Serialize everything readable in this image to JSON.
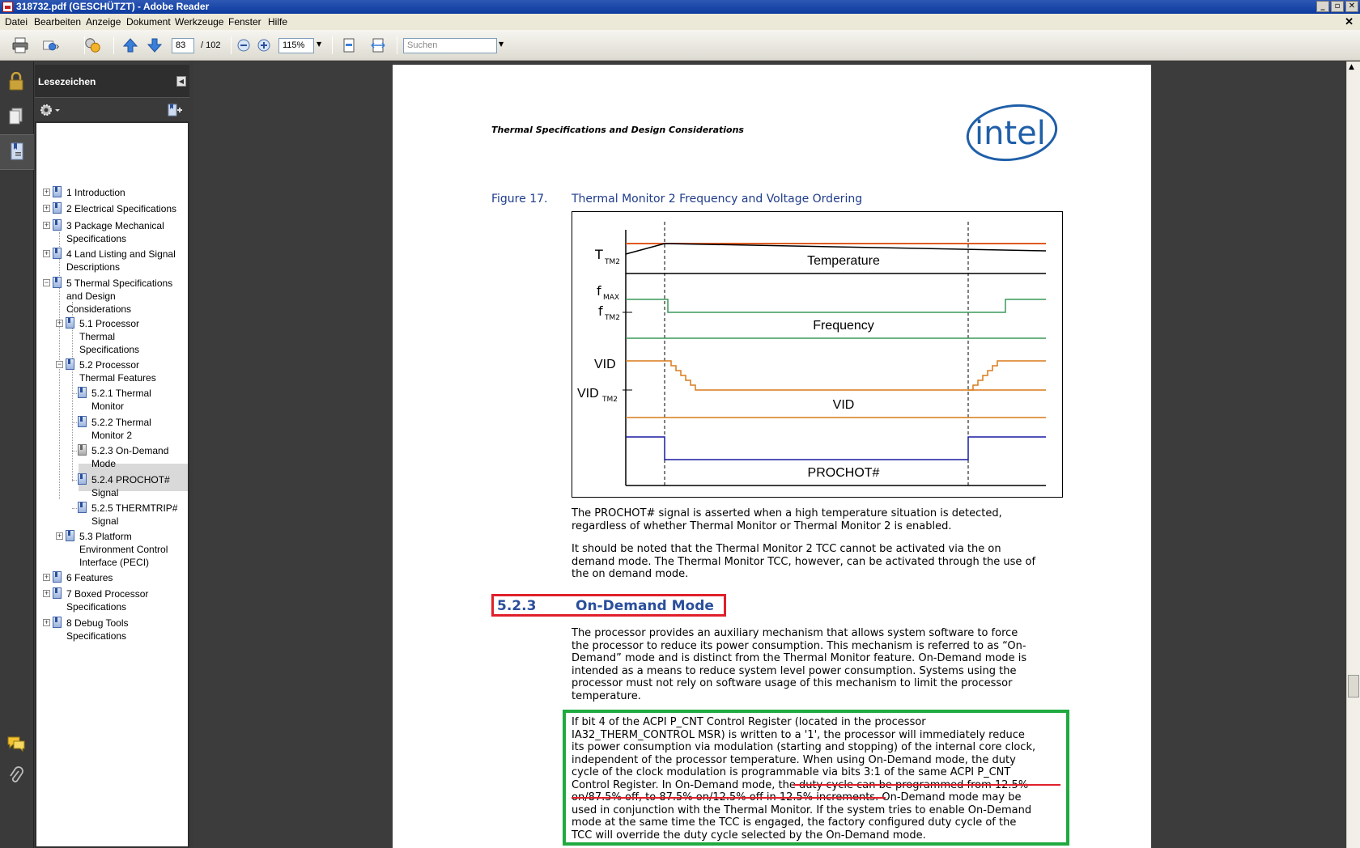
{
  "window": {
    "title": "318732.pdf (GESCHÜTZT) - Adobe Reader"
  },
  "menu": [
    "Datei",
    "Bearbeiten",
    "Anzeige",
    "Dokument",
    "Werkzeuge",
    "Fenster",
    "Hilfe"
  ],
  "toolbar": {
    "page_current": "83",
    "page_total": "/ 102",
    "zoom": "115%",
    "search_placeholder": "Suchen"
  },
  "bookmarks": {
    "title": "Lesezeichen",
    "items": [
      {
        "lines": [
          "1 Introduction"
        ]
      },
      {
        "lines": [
          "2 Electrical Specifications"
        ]
      },
      {
        "lines": [
          "3 Package Mechanical",
          "Specifications"
        ]
      },
      {
        "lines": [
          "4 Land Listing and Signal",
          "Descriptions"
        ]
      },
      {
        "lines": [
          "5 Thermal Specifications",
          "and Design",
          "Considerations"
        ]
      },
      {
        "lines": [
          "5.1 Processor",
          "Thermal",
          "Specifications"
        ]
      },
      {
        "lines": [
          "5.2 Processor",
          "Thermal Features"
        ]
      },
      {
        "lines": [
          "5.2.1 Thermal",
          "Monitor"
        ]
      },
      {
        "lines": [
          "5.2.2 Thermal",
          "Monitor 2"
        ]
      },
      {
        "lines": [
          "5.2.3 On-Demand",
          "Mode"
        ]
      },
      {
        "lines": [
          "5.2.4 PROCHOT#",
          "Signal"
        ]
      },
      {
        "lines": [
          "5.2.5 THERMTRIP#",
          "Signal"
        ]
      },
      {
        "lines": [
          "5.3 Platform",
          "Environment Control",
          "Interface (PECI)"
        ]
      },
      {
        "lines": [
          "6 Features"
        ]
      },
      {
        "lines": [
          "7 Boxed Processor",
          "Specifications"
        ]
      },
      {
        "lines": [
          "8 Debug Tools",
          "Specifications"
        ]
      }
    ]
  },
  "document": {
    "running_header": "Thermal Specifications and Design Considerations",
    "logo_text": "intel",
    "figure": {
      "number": "Figure 17.",
      "title": "Thermal Monitor 2 Frequency and Voltage Ordering",
      "labels": {
        "ttm2_main": "T",
        "ttm2_sub": "TM2",
        "fmax_main": "f",
        "fmax_sub": "MAX",
        "ftm2_main": "f",
        "ftm2_sub": "TM2",
        "vid_left": "VID",
        "vidtm2_main": "VID",
        "vidtm2_sub": "TM2",
        "temperature": "Temperature",
        "frequency": "Frequency",
        "vid_center": "VID",
        "prochot": "PROCHOT#"
      }
    },
    "para1": [
      "The PROCHOT# signal is asserted when a high temperature situation is detected,",
      "regardless of whether Thermal Monitor or Thermal Monitor 2 is enabled."
    ],
    "para2": [
      "It should be noted that the Thermal Monitor 2 TCC cannot be activated via the on",
      "demand mode. The Thermal Monitor TCC, however, can be activated through the use of",
      "the on demand mode."
    ],
    "section": {
      "number": "5.2.3",
      "title": "On-Demand Mode"
    },
    "para3": [
      "The processor provides an auxiliary mechanism that allows system software to force",
      "the processor to reduce its power consumption. This mechanism is referred to as “On-",
      "Demand” mode and is distinct from the Thermal Monitor feature. On-Demand mode is",
      "intended as a means to reduce system level power consumption. Systems using the",
      "processor must not rely on software usage of this mechanism to limit the processor",
      "temperature."
    ],
    "para4": [
      "If bit 4 of the ACPI P_CNT Control Register (located in the processor",
      "IA32_THERM_CONTROL MSR) is written to a '1', the processor will immediately reduce",
      "its power consumption via modulation (starting and stopping) of the internal core clock,",
      "independent of the processor temperature. When using On-Demand mode, the duty",
      "cycle of the clock modulation is programmable via bits 3:1 of the same ACPI P_CNT",
      "Control Register. In On-Demand mode, the duty cycle can be programmed from 12.5%",
      "on/87.5% off, to 87.5% on/12.5% off in 12.5% increments. On-Demand mode may be",
      "used in conjunction with the Thermal Monitor. If the system tries to enable On-Demand",
      "mode at the same time the TCC is engaged, the factory configured duty cycle of the",
      "TCC will override the duty cycle selected by the On-Demand mode."
    ]
  },
  "colors": {
    "temperature": "#e05a1e",
    "frequency": "#3a9a5a",
    "vid": "#d97a1a",
    "prochot": "#1a1aa0",
    "caption": "#1f3c8c",
    "highlight_red": "#e0202a",
    "highlight_green": "#1faa3f"
  }
}
